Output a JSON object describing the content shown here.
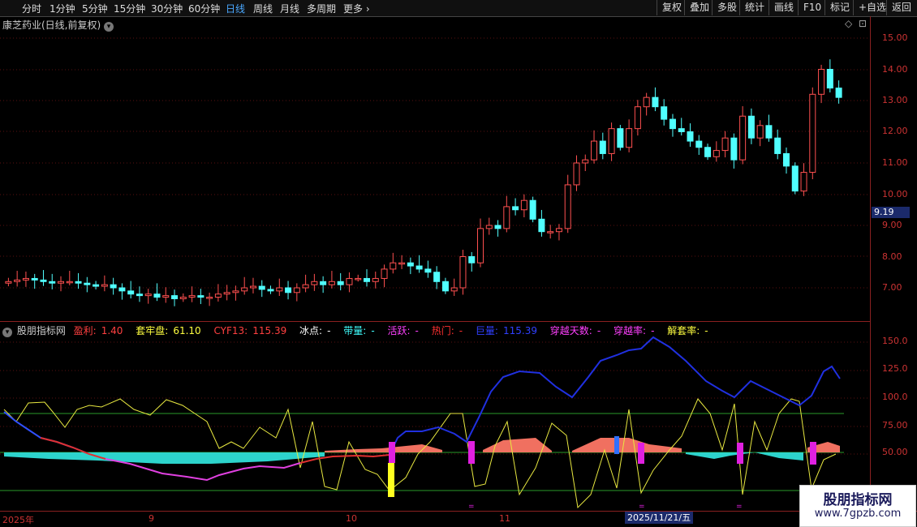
{
  "toolbar": {
    "timeframes": [
      "分时",
      "1分钟",
      "5分钟",
      "15分钟",
      "30分钟",
      "60分钟",
      "日线",
      "周线",
      "月线",
      "多周期",
      "更多"
    ],
    "active_timeframe": "日线",
    "buttons": [
      "复权",
      "叠加",
      "多股",
      "统计",
      "画线",
      "F10",
      "标记",
      "+自选",
      "返回"
    ]
  },
  "stock_title": "康芝药业(日线,前复权)",
  "price_axis": [
    "15.00",
    "14.00",
    "13.00",
    "12.00",
    "11.00",
    "10.00",
    "9.00",
    "8.00",
    "7.00"
  ],
  "current_price_label": "9.19",
  "indicator": {
    "name": "股朋指标网",
    "items": [
      {
        "label": "盈利:",
        "value": "1.40",
        "color": "#ff4040"
      },
      {
        "label": "套牢盘:",
        "value": "61.10",
        "color": "#ffff40"
      },
      {
        "label": "CYF13:",
        "value": "115.39",
        "color": "#ff4040"
      },
      {
        "label": "冰点:",
        "value": "-",
        "color": "#ffffff"
      },
      {
        "label": "带量:",
        "value": "-",
        "color": "#40ffff"
      },
      {
        "label": "活跃:",
        "value": "-",
        "color": "#ff40ff"
      },
      {
        "label": "热门:",
        "value": "-",
        "color": "#ff3030"
      },
      {
        "label": "巨量:",
        "value": "115.39",
        "color": "#3040ff"
      },
      {
        "label": "穿越天数:",
        "value": "-",
        "color": "#ff40ff"
      },
      {
        "label": "穿越率:",
        "value": "-",
        "color": "#ff40ff"
      },
      {
        "label": "解套率:",
        "value": "-",
        "color": "#ffff40"
      }
    ]
  },
  "indicator_axis": [
    "150.0",
    "125.0",
    "100.0",
    "75.00",
    "50.00"
  ],
  "date_axis": [
    "2025年",
    "9",
    "10",
    "11"
  ],
  "current_date_label": "2025/11/21/五",
  "watermark": {
    "title": "股朋指标网",
    "url": "www.7gpzb.com"
  },
  "colors": {
    "up": "#ff5050",
    "down": "#50ffff",
    "active": "#4aa8ff",
    "axis": "#c33333"
  }
}
